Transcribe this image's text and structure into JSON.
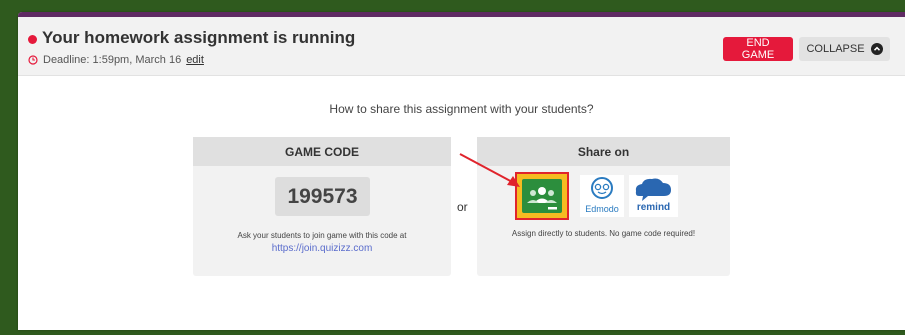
{
  "header": {
    "title": "Your homework assignment is running",
    "deadline_text": "Deadline: 1:59pm, March 16",
    "edit_label": "edit",
    "end_game_label": "END GAME",
    "collapse_label": "COLLAPSE"
  },
  "main": {
    "question": "How to share this assignment with your students?",
    "or_label": "or"
  },
  "game_code": {
    "heading": "GAME CODE",
    "code": "199573",
    "help": "Ask your students to join game with this code at",
    "link": "https://join.quizizz.com"
  },
  "share": {
    "heading": "Share on",
    "edmodo_label": "Edmodo",
    "remind_label": "remind",
    "help": "Assign directly to students. No game code required!"
  },
  "colors": {
    "accent_red": "#e5193b",
    "brand_purple": "#5f2a63",
    "link_blue": "#5a6ccc"
  },
  "icons": [
    "status-dot-icon",
    "clock-icon",
    "chevron-up-icon",
    "google-classroom-icon",
    "edmodo-icon",
    "remind-icon",
    "annotation-arrow-icon"
  ]
}
